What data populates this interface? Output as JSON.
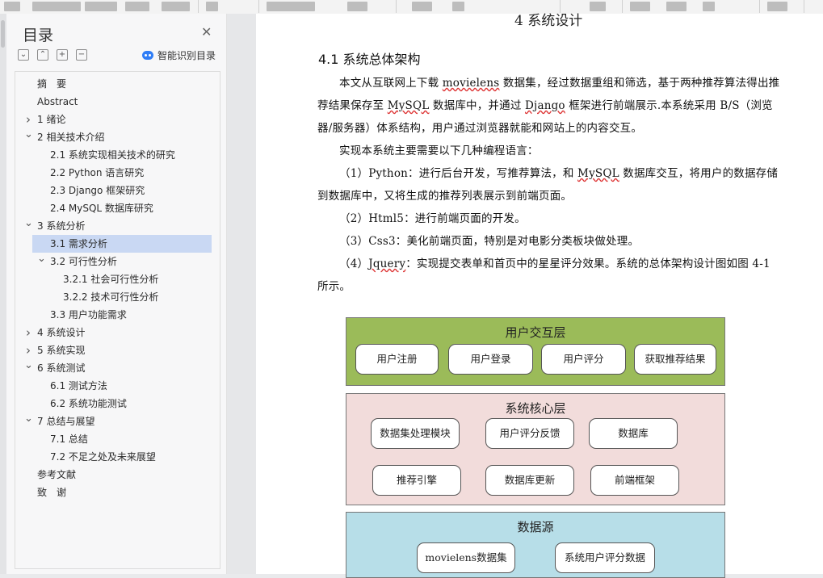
{
  "toc": {
    "title": "目录",
    "smart_label": "智能识别目录",
    "items": [
      {
        "label": "摘　要",
        "level": 0,
        "chevron": ""
      },
      {
        "label": "Abstract",
        "level": 0,
        "chevron": ""
      },
      {
        "label": "1 绪论",
        "level": 0,
        "chevron": ">"
      },
      {
        "label": "2 相关技术介绍",
        "level": 0,
        "chevron": "v"
      },
      {
        "label": "2.1 系统实现相关技术的研究",
        "level": 1,
        "chevron": ""
      },
      {
        "label": "2.2 Python 语言研究",
        "level": 1,
        "chevron": ""
      },
      {
        "label": "2.3 Django 框架研究",
        "level": 1,
        "chevron": ""
      },
      {
        "label": "2.4 MySQL 数据库研究",
        "level": 1,
        "chevron": ""
      },
      {
        "label": "3 系统分析",
        "level": 0,
        "chevron": "v"
      },
      {
        "label": "3.1 需求分析",
        "level": 1,
        "chevron": "",
        "selected": true
      },
      {
        "label": "3.2 可行性分析",
        "level": 1,
        "chevron": "v"
      },
      {
        "label": "3.2.1 社会可行性分析",
        "level": 2,
        "chevron": ""
      },
      {
        "label": "3.2.2  技术可行性分析",
        "level": 2,
        "chevron": ""
      },
      {
        "label": "3.3 用户功能需求",
        "level": 1,
        "chevron": ""
      },
      {
        "label": "4 系统设计",
        "level": 0,
        "chevron": ">"
      },
      {
        "label": "5 系统实现",
        "level": 0,
        "chevron": ">"
      },
      {
        "label": "6 系统测试",
        "level": 0,
        "chevron": "v"
      },
      {
        "label": "6.1 测试方法",
        "level": 1,
        "chevron": ""
      },
      {
        "label": "6.2 系统功能测试",
        "level": 1,
        "chevron": ""
      },
      {
        "label": "7 总结与展望",
        "level": 0,
        "chevron": "v"
      },
      {
        "label": "7.1 总结",
        "level": 1,
        "chevron": ""
      },
      {
        "label": "7.2 不足之处及未来展望",
        "level": 1,
        "chevron": ""
      },
      {
        "label": "参考文献",
        "level": 0,
        "chevron": ""
      },
      {
        "label": "致　谢",
        "level": 0,
        "chevron": ""
      }
    ]
  },
  "doc": {
    "chapter_title": "4 系统设计",
    "section_heading": "4.1 系统总体架构",
    "p1_a": "本文从互联网上下载 ",
    "p1_u1": "movielens",
    "p1_b": " 数据集，经过数据重组和筛选，基于两种推荐算法得出推荐结果保存至 ",
    "p1_u2": "MySQL",
    "p1_c": " 数据库中，并通过 ",
    "p1_u3": "Django",
    "p1_d": " 框架进行前端展示.本系统采用 B/S（浏览器/服务器）体系结构，用户通过浏览器就能和网站上的内容交互。",
    "p2": "实现本系统主要需要以下几种编程语言：",
    "p3_a": "（1）Python：进行后台开发，写推荐算法，和 ",
    "p3_u": "MySQL",
    "p3_b": " 数据库交互，将用户的数据存储到数据库中，又将生成的推荐列表展示到前端页面。",
    "p4": "（2）Html5：进行前端页面的开发。",
    "p5": "（3）Css3：美化前端页面，特别是对电影分类板块做处理。",
    "p6_a": "（4）",
    "p6_u": "Jquery",
    "p6_b": "：实现提交表单和首页中的星星评分效果。系统的总体架构设计图如图 4-1 所示。"
  },
  "diagram": {
    "layer1_title": "用户交互层",
    "layer1_boxes": [
      "用户注册",
      "用户登录",
      "用户评分",
      "获取推荐结果"
    ],
    "layer2_title": "系统核心层",
    "layer2_boxes": [
      "数据集处理模块",
      "用户评分反馈",
      "数据库",
      "推荐引擎",
      "数据库更新",
      "前端框架"
    ],
    "layer3_title": "数据源",
    "layer3_boxes": [
      "movielens数据集",
      "系统用户评分数据"
    ]
  },
  "colors": {
    "layer1": "#9bbb59",
    "layer2": "#f2dcdb",
    "layer3": "#b7dee8",
    "toc_selected": "#c9d8f3"
  }
}
